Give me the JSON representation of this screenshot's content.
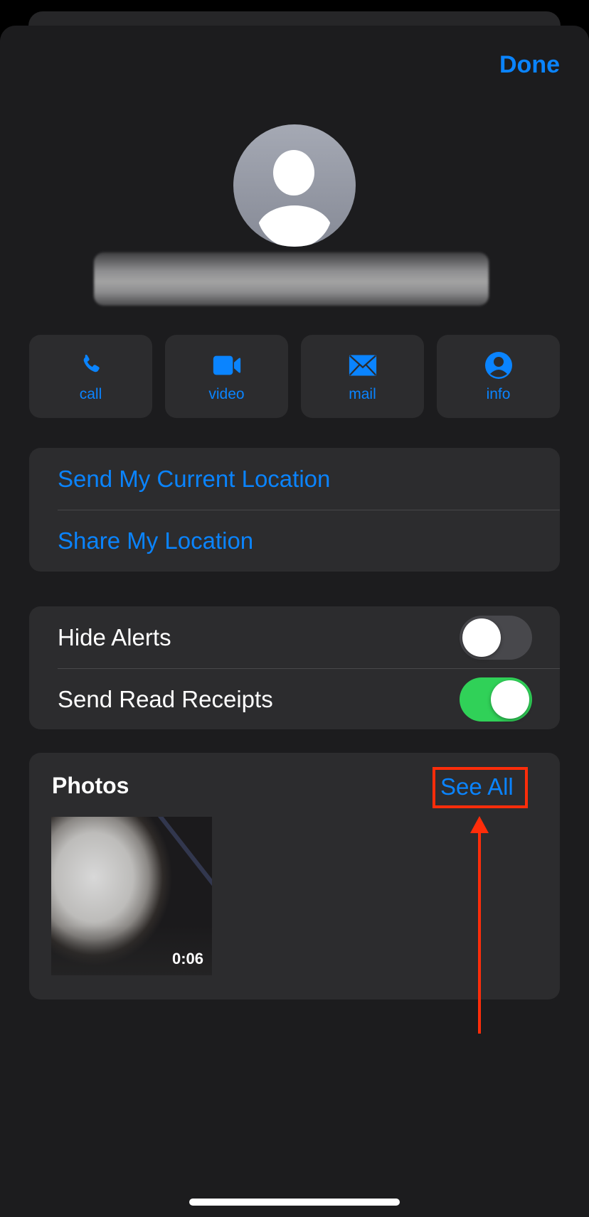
{
  "header": {
    "done_label": "Done"
  },
  "contact": {
    "avatar_icon": "person-silhouette-icon",
    "name_redacted": "blurred contact email"
  },
  "actions": [
    {
      "label": "call",
      "icon": "phone-icon"
    },
    {
      "label": "video",
      "icon": "video-camera-icon"
    },
    {
      "label": "mail",
      "icon": "envelope-icon"
    },
    {
      "label": "info",
      "icon": "person-circle-icon"
    }
  ],
  "location": {
    "items": [
      {
        "label": "Send My Current Location"
      },
      {
        "label": "Share My Location"
      }
    ]
  },
  "settings": {
    "items": [
      {
        "label": "Hide Alerts",
        "on": false
      },
      {
        "label": "Send Read Receipts",
        "on": true
      }
    ]
  },
  "photos": {
    "title": "Photos",
    "see_all_label": "See All",
    "items": [
      {
        "type": "video",
        "duration": "0:06"
      }
    ]
  },
  "annotation": {
    "highlight_target": "See All",
    "color": "#ff2d0a"
  },
  "colors": {
    "accent": "#0a84ff",
    "toggle_on": "#30d158",
    "background": "#1c1c1e",
    "card": "#2c2c2e"
  }
}
